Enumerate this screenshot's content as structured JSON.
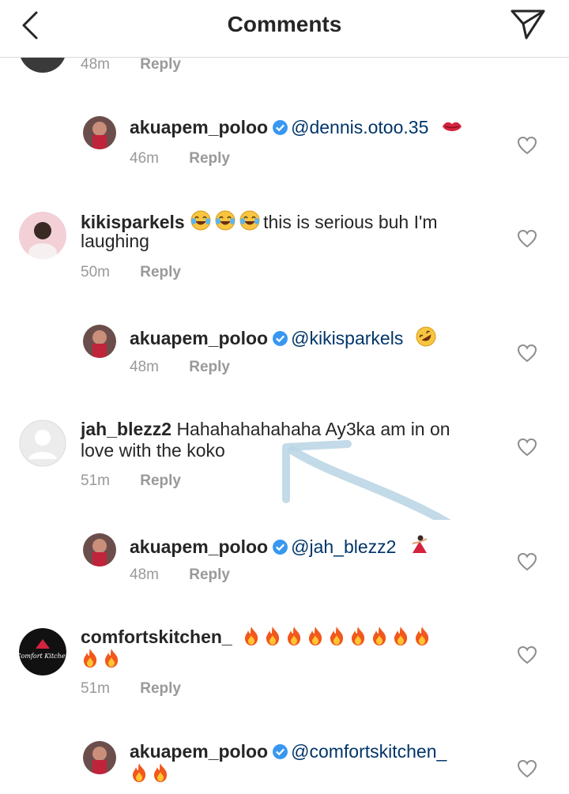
{
  "header": {
    "title": "Comments",
    "back_icon": "chevron-left-icon",
    "send_icon": "paper-plane-icon"
  },
  "colors": {
    "username": "#262626",
    "mention": "#003569",
    "meta": "#999999",
    "verified": "#3897f0",
    "divider": "#dbdbdb"
  },
  "comments": [
    {
      "time": "48m",
      "reply_label": "Reply"
    },
    {
      "username": "akuapem_poloo",
      "verified": true,
      "text": "@dennis.otoo.35",
      "emoji": "kiss-mark-icon",
      "time": "46m",
      "reply_label": "Reply"
    },
    {
      "username": "kikisparkels",
      "verified": false,
      "text_line1": "this is serious buh I'm",
      "text_line2": "laughing",
      "emoji": "tears-of-joy-icon",
      "time": "50m",
      "reply_label": "Reply"
    },
    {
      "username": "akuapem_poloo",
      "verified": true,
      "text": "@kikisparkels",
      "emoji": "rofl-icon",
      "time": "48m",
      "reply_label": "Reply"
    },
    {
      "username": "jah_blezz2",
      "verified": false,
      "text_line1": "Hahahahahahaha Ay3ka am in on",
      "text_line2": "love with the koko",
      "time": "51m",
      "reply_label": "Reply"
    },
    {
      "username": "akuapem_poloo",
      "verified": true,
      "text": "@jah_blezz2",
      "emoji": "dancer-icon",
      "time": "48m",
      "reply_label": "Reply"
    },
    {
      "username": "comfortskitchen_",
      "verified": false,
      "emoji": "fire-icon",
      "time": "51m",
      "reply_label": "Reply"
    },
    {
      "username": "akuapem_poloo",
      "verified": true,
      "text": "@comfortskitchen_",
      "emoji": "fire-icon"
    }
  ]
}
